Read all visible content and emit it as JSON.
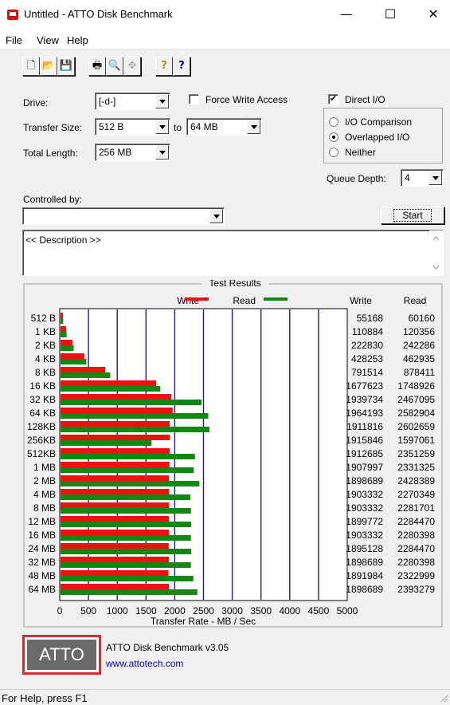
{
  "window": {
    "title": "Untitled - ATTO Disk Benchmark",
    "minimize": "—",
    "maximize": "☐",
    "close": "✕"
  },
  "menu": [
    "File",
    "View",
    "Help"
  ],
  "toolbar": [
    "🗋",
    "📂",
    "💾",
    "🖶",
    "🔍",
    "✥",
    "?",
    "?"
  ],
  "form": {
    "drive_label": "Drive:",
    "drive_value": "[-d-]",
    "force_write_label": "Force Write Access",
    "force_write_checked": false,
    "direct_io_label": "Direct I/O",
    "direct_io_checked": true,
    "io_comparison_label": "I/O Comparison",
    "overlapped_io_label": "Overlapped I/O",
    "neither_label": "Neither",
    "selected_io": "overlapped",
    "transfer_size_label": "Transfer Size:",
    "transfer_from": "512 B",
    "to_label": "to",
    "transfer_to": "64 MB",
    "total_length_label": "Total Length:",
    "total_length_value": "256 MB",
    "queue_depth_label": "Queue Depth:",
    "queue_depth_value": "4",
    "controlled_by_label": "Controlled by:",
    "controlled_by_value": "",
    "start_label": "Start",
    "description": "<< Description >>"
  },
  "results_title": "Test Results",
  "legend": {
    "write": "Write",
    "read": "Read"
  },
  "columns": {
    "write": "Write",
    "read": "Read"
  },
  "colors": {
    "write": "#ee1111",
    "read": "#118811",
    "grid": "#1a1aa0",
    "brand": "#d32f2f"
  },
  "chart_data": {
    "type": "bar",
    "orientation": "horizontal",
    "categories": [
      "512 B",
      "1 KB",
      "2 KB",
      "4 KB",
      "8 KB",
      "16 KB",
      "32 KB",
      "64 KB",
      "128KB",
      "256KB",
      "512KB",
      "1 MB",
      "2 MB",
      "4 MB",
      "8 MB",
      "12 MB",
      "16 MB",
      "24 MB",
      "32 MB",
      "48 MB",
      "64 MB"
    ],
    "series": [
      {
        "name": "Write",
        "values": [
          55168,
          110884,
          222830,
          428253,
          791514,
          1677623,
          1939734,
          1964193,
          1911816,
          1915846,
          1912685,
          1907997,
          1898689,
          1903332,
          1903332,
          1899772,
          1903332,
          1895128,
          1898689,
          1891984,
          1898689
        ]
      },
      {
        "name": "Read",
        "values": [
          60160,
          120356,
          242286,
          462935,
          878411,
          1748926,
          2467095,
          2582904,
          2602659,
          1597061,
          2351259,
          2331325,
          2428389,
          2270349,
          2281701,
          2284470,
          2280398,
          2284470,
          2280398,
          2322999,
          2393279
        ]
      }
    ],
    "xlabel": "Transfer Rate - MB / Sec",
    "xticks": [
      "0",
      "500",
      "1000",
      "1500",
      "2000",
      "2500",
      "3000",
      "3500",
      "4000",
      "4500",
      "5000"
    ],
    "xlim": [
      0,
      5000
    ],
    "grid": true
  },
  "brand": {
    "logo": "ATTO",
    "version": "ATTO Disk Benchmark v3.05",
    "url": "www.attotech.com"
  },
  "status": "For Help, press F1"
}
